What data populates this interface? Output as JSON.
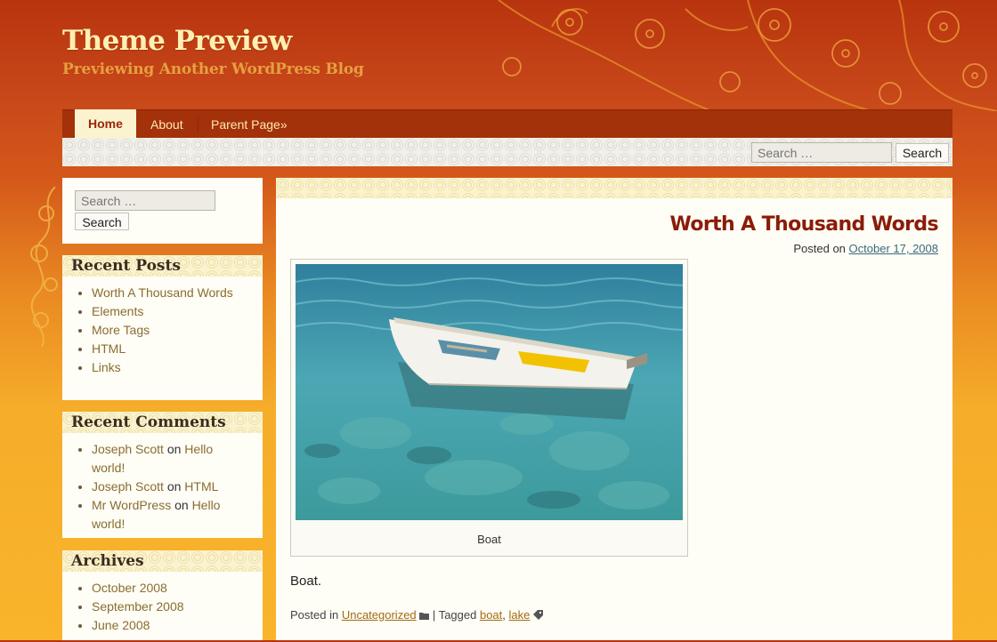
{
  "site": {
    "title": "Theme Preview",
    "description": "Previewing Another WordPress Blog"
  },
  "nav": {
    "items": [
      {
        "label": "Home"
      },
      {
        "label": "About"
      },
      {
        "label": "Parent Page»"
      }
    ]
  },
  "header_search": {
    "placeholder": "Search …",
    "button_label": "Search"
  },
  "sidebar": {
    "search": {
      "placeholder": "Search …",
      "button_label": "Search"
    },
    "recent_posts": {
      "title": "Recent Posts",
      "items": [
        "Worth A Thousand Words",
        "Elements",
        "More Tags",
        "HTML",
        "Links"
      ]
    },
    "recent_comments": {
      "title": "Recent Comments",
      "items": [
        {
          "author": "Joseph Scott",
          "on": "on",
          "post": "Hello world!"
        },
        {
          "author": "Joseph Scott",
          "on": "on",
          "post": "HTML"
        },
        {
          "author": "Mr WordPress",
          "on": "on",
          "post": "Hello world!"
        }
      ]
    },
    "archives": {
      "title": "Archives",
      "items": [
        "October 2008",
        "September 2008",
        "June 2008"
      ]
    }
  },
  "post": {
    "title": "Worth A Thousand Words",
    "meta_prefix": "Posted on",
    "date": "October 17, 2008",
    "image_caption": "Boat",
    "body": "Boat.",
    "footer": {
      "posted_in_label": "Posted in",
      "category": "Uncategorized",
      "separator": "|",
      "tagged_label": "Tagged",
      "tags": [
        "boat",
        "lake"
      ],
      "tag_separator": ","
    }
  },
  "colors": {
    "header_red": "#b8340e",
    "background_orange": "#f9b42b",
    "nav_bar": "#a3310a",
    "title_cream": "#fdf0b2",
    "post_title": "#8a1c08",
    "link_brown": "#8a6d2f"
  },
  "icons": {
    "category": "folder-icon",
    "tag": "tag-icon",
    "header_decoration": "cherry-blossom-branch",
    "side_decoration": "floral-ornament"
  }
}
